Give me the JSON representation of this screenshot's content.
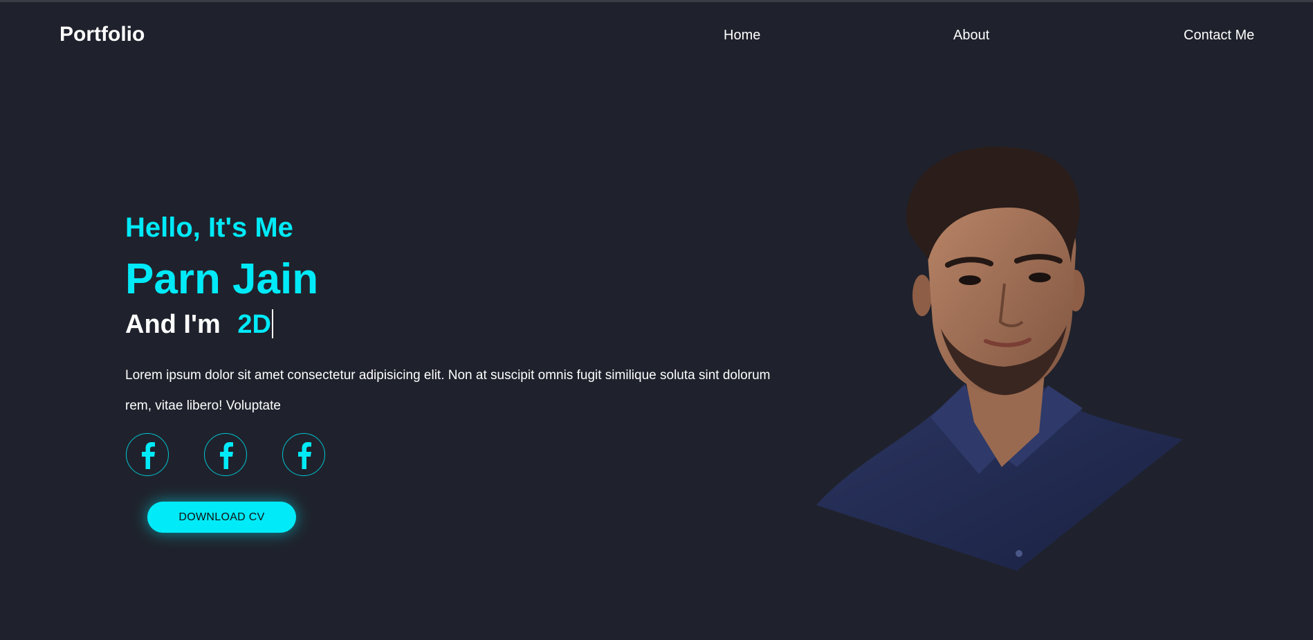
{
  "header": {
    "logo": "Portfolio",
    "nav": {
      "home": "Home",
      "about": "About",
      "contact": "Contact Me"
    }
  },
  "hero": {
    "greeting": "Hello, It's Me",
    "name": "Parn Jain",
    "role_prefix": "And I'm",
    "role_typed": "2D",
    "description": "Lorem ipsum dolor sit amet consectetur adipisicing elit. Non at suscipit omnis fugit similique soluta sint dolorum rem, vitae libero! Voluptate",
    "socials": [
      {
        "icon": "facebook-icon"
      },
      {
        "icon": "facebook-icon"
      },
      {
        "icon": "facebook-icon"
      }
    ],
    "cta_label": "DOWNLOAD CV"
  },
  "colors": {
    "background": "#1f222c",
    "accent": "#00eaf8",
    "text": "#ffffff"
  }
}
